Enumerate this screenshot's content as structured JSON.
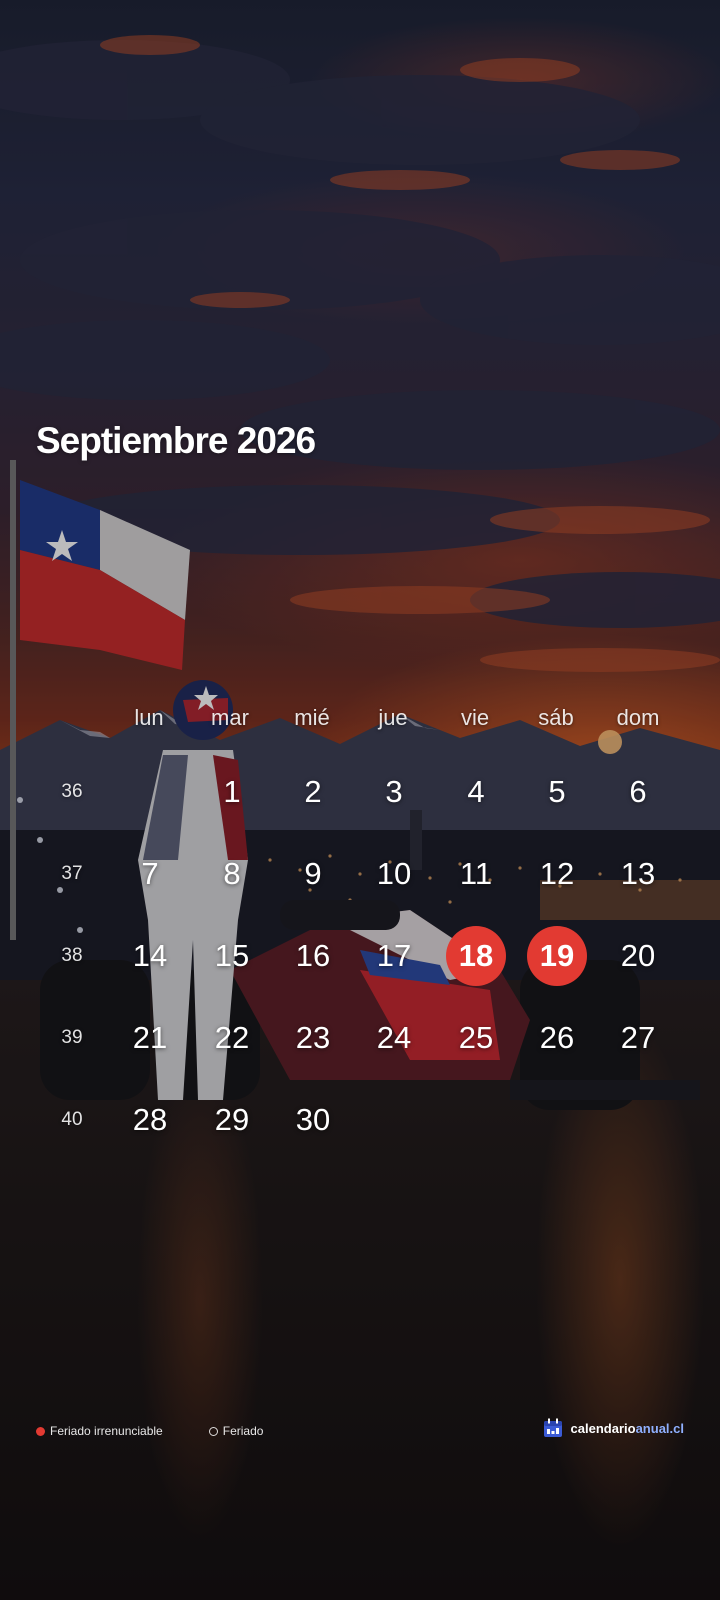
{
  "calendar": {
    "title": "Septiembre 2026",
    "weekdays": [
      "lun",
      "mar",
      "mié",
      "jue",
      "vie",
      "sáb",
      "dom"
    ],
    "weeks": [
      {
        "number": "36",
        "days": [
          "",
          "1",
          "2",
          "3",
          "4",
          "5",
          "6"
        ]
      },
      {
        "number": "37",
        "days": [
          "7",
          "8",
          "9",
          "10",
          "11",
          "12",
          "13"
        ]
      },
      {
        "number": "38",
        "days": [
          "14",
          "15",
          "16",
          "17",
          "18",
          "19",
          "20"
        ]
      },
      {
        "number": "39",
        "days": [
          "21",
          "22",
          "23",
          "24",
          "25",
          "26",
          "27"
        ]
      },
      {
        "number": "40",
        "days": [
          "28",
          "29",
          "30",
          "",
          "",
          "",
          ""
        ]
      }
    ],
    "holidays_irrenunciable": [
      "18",
      "19"
    ]
  },
  "legend": {
    "irrenunciable_label": "Feriado irrenunciable",
    "holiday_label": "Feriado"
  },
  "brand": {
    "name_part1": "calendario",
    "name_part2": "anual.cl"
  },
  "colors": {
    "holiday_irrenunciable": "#e23a32",
    "brand_accent": "#8fb0ff"
  }
}
